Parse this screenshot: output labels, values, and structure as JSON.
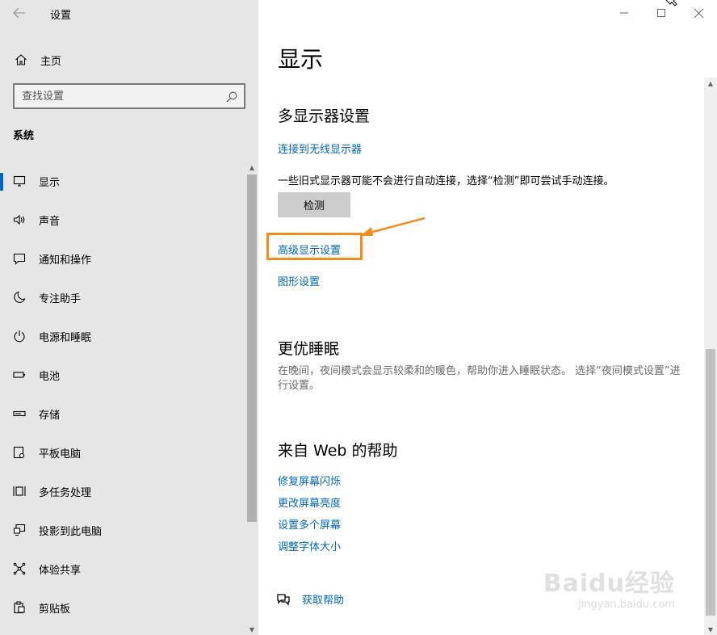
{
  "app": {
    "title": "设置"
  },
  "sidebar": {
    "home_label": "主页",
    "search_placeholder": "查找设置",
    "section_label": "系统",
    "items": [
      {
        "label": "显示",
        "icon": "monitor-icon",
        "active": true
      },
      {
        "label": "声音",
        "icon": "speaker-icon"
      },
      {
        "label": "通知和操作",
        "icon": "notification-icon"
      },
      {
        "label": "专注助手",
        "icon": "moon-icon"
      },
      {
        "label": "电源和睡眠",
        "icon": "power-icon"
      },
      {
        "label": "电池",
        "icon": "battery-icon"
      },
      {
        "label": "存储",
        "icon": "storage-icon"
      },
      {
        "label": "平板电脑",
        "icon": "tablet-icon"
      },
      {
        "label": "多任务处理",
        "icon": "multitask-icon"
      },
      {
        "label": "投影到此电脑",
        "icon": "project-icon"
      },
      {
        "label": "体验共享",
        "icon": "share-icon"
      },
      {
        "label": "剪贴板",
        "icon": "clipboard-icon"
      }
    ]
  },
  "main": {
    "page_title": "显示",
    "multi_display": {
      "heading": "多显示器设置",
      "wireless_link": "连接到无线显示器",
      "description": "一些旧式显示器可能不会进行自动连接，选择“检测”即可尝试手动连接。",
      "detect_button": "检测",
      "advanced_link": "高级显示设置",
      "graphics_link": "图形设置"
    },
    "sleep": {
      "heading": "更优睡眠",
      "description": "在晚间，夜间模式会显示较柔和的暖色，帮助你进入睡眠状态。 选择“夜间模式设置”进行设置。"
    },
    "web_help": {
      "heading": "来自 Web 的帮助",
      "links": [
        "修复屏幕闪烁",
        "更改屏幕亮度",
        "设置多个屏幕",
        "调整字体大小"
      ]
    },
    "get_help": "获取帮助"
  },
  "watermark": {
    "logo": "Baidu经验",
    "url": "jingyan.baidu.com"
  },
  "colors": {
    "accent": "#0067b8",
    "highlight": "#f28c1e",
    "sidebar_bg": "#e6e6e6"
  }
}
